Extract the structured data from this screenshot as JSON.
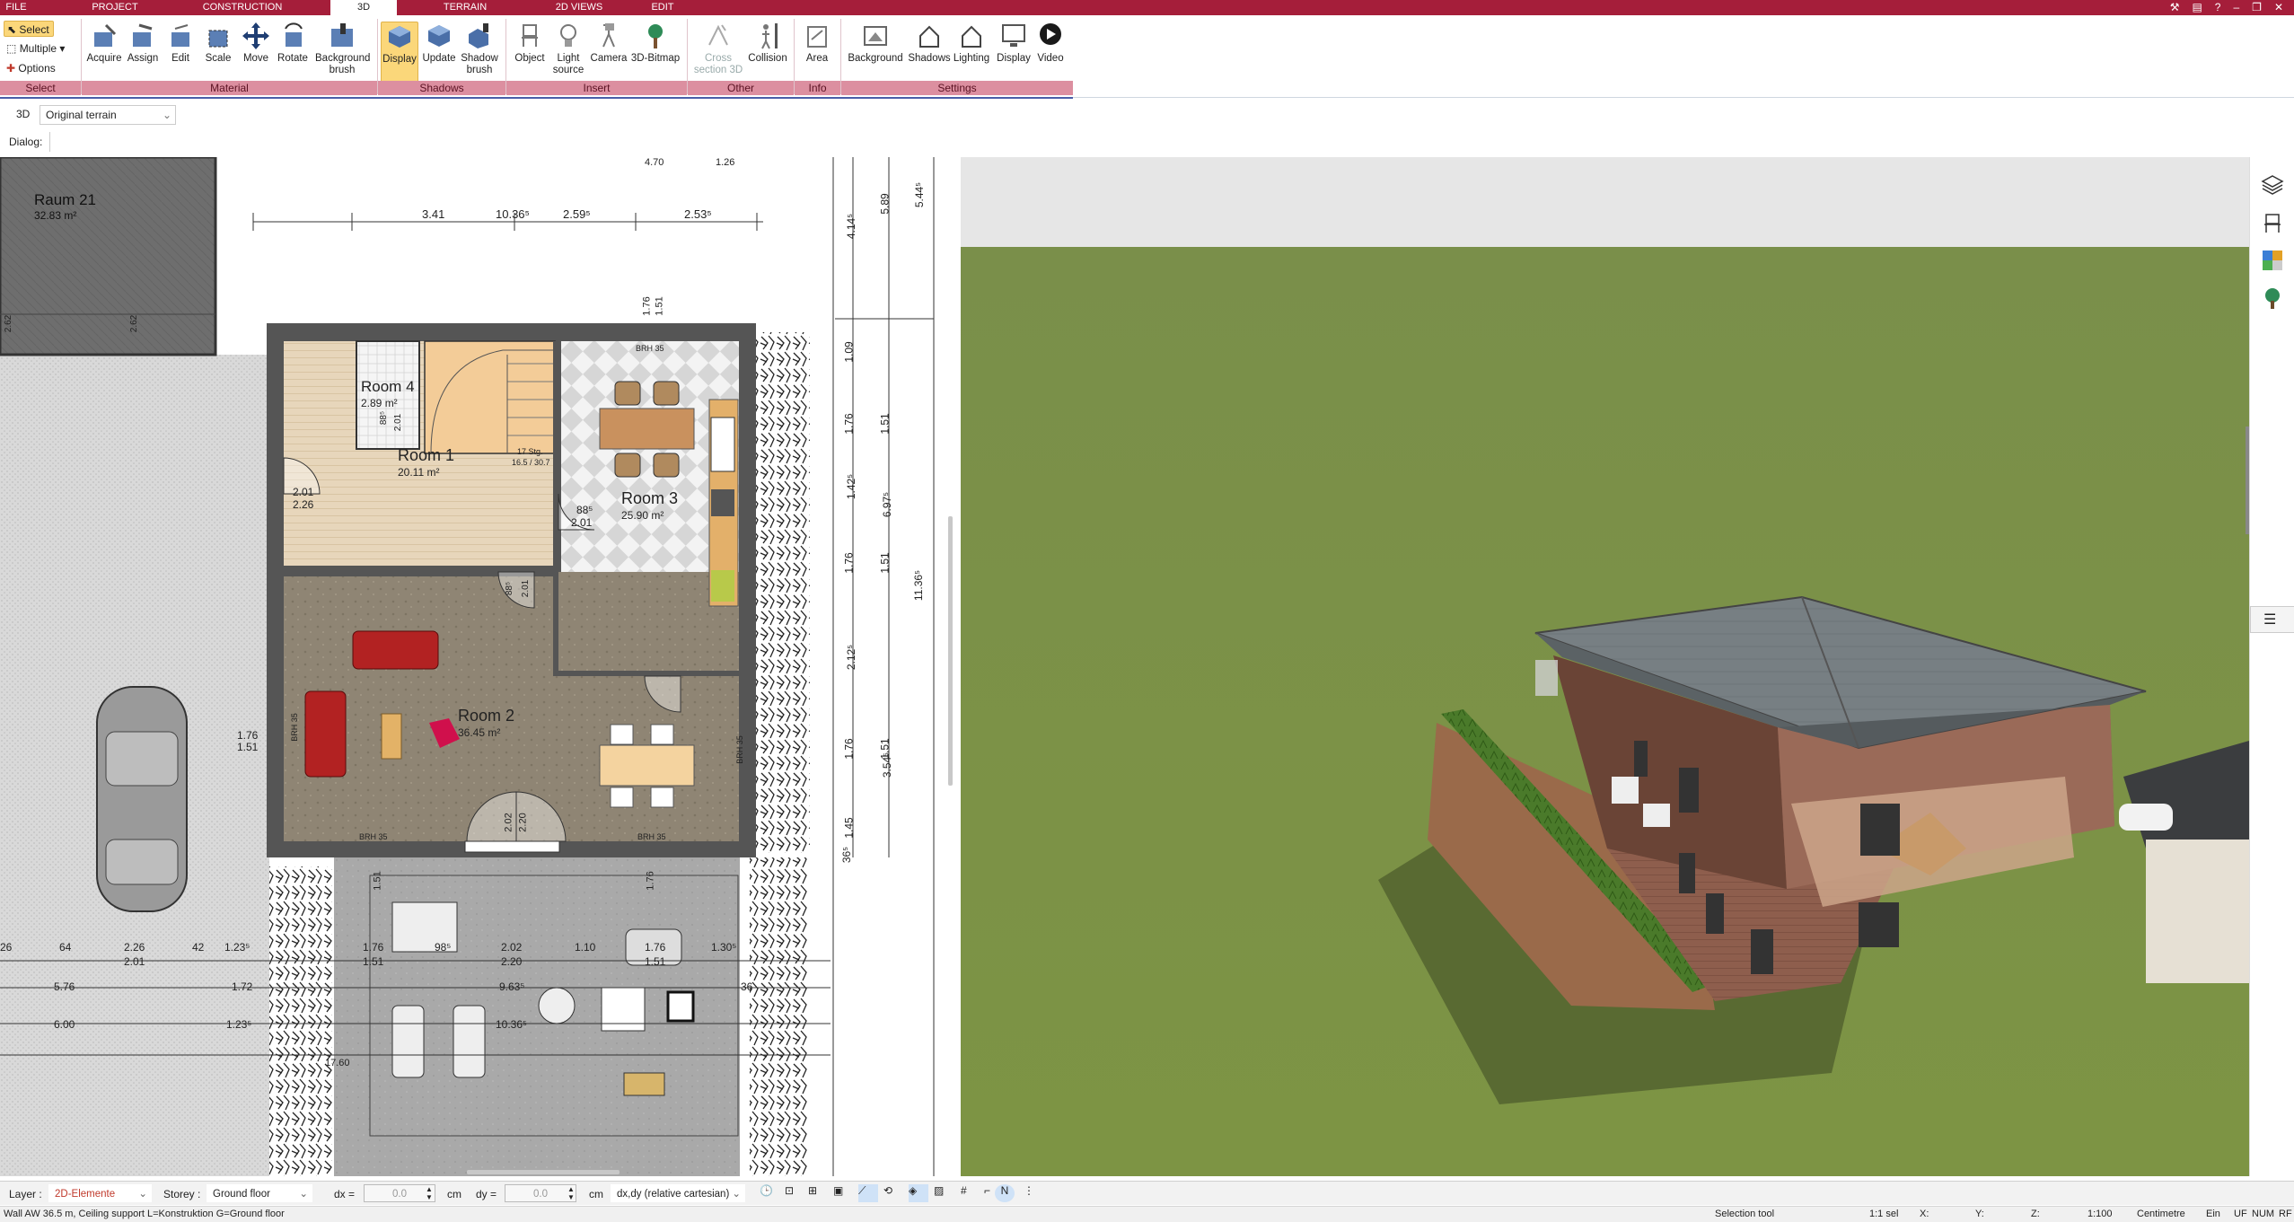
{
  "menu": {
    "tabs": [
      "FILE",
      "PROJECT",
      "CONSTRUCTION",
      "3D",
      "TERRAIN",
      "2D VIEWS",
      "EDIT"
    ],
    "active": "3D"
  },
  "ribbon": {
    "select": {
      "select_label": "Select",
      "multiple_label": "Multiple",
      "options_label": "Options"
    },
    "material": {
      "acquire": "Acquire",
      "assign": "Assign",
      "edit": "Edit",
      "scale": "Scale",
      "move": "Move",
      "rotate": "Rotate",
      "background_brush": "Background brush"
    },
    "shadows": {
      "display": "Display",
      "update": "Update",
      "shadow_brush": "Shadow brush"
    },
    "insert": {
      "object": "Object",
      "light_source": "Light source",
      "camera": "Camera",
      "bitmap": "3D-Bitmap"
    },
    "other": {
      "cross_section": "Cross section 3D",
      "collision": "Collision"
    },
    "info": {
      "area": "Area"
    },
    "settings": {
      "background": "Background",
      "shadows": "Shadows",
      "lighting": "Lighting",
      "display": "Display",
      "video": "Video"
    },
    "groups": {
      "select": "Select",
      "material": "Material",
      "shadows": "Shadows",
      "insert": "Insert",
      "other": "Other",
      "info": "Info",
      "settings": "Settings"
    }
  },
  "toolbar2": {
    "mode": "3D",
    "terrain_value": "Original terrain"
  },
  "dialog": {
    "label": "Dialog:"
  },
  "plan": {
    "rooms": [
      {
        "name": "Raum 21",
        "area": "32.83 m²"
      },
      {
        "name": "Room 4",
        "area": "2.89 m²"
      },
      {
        "name": "Room 1",
        "area": "20.11 m²"
      },
      {
        "name": "Room 3",
        "area": "25.90 m²"
      },
      {
        "name": "Room 2",
        "area": "36.45 m²"
      }
    ],
    "top_dims": [
      "3.41",
      "10.36⁵",
      "2.59⁵",
      "2.53⁵"
    ],
    "top_dims_small": [
      "4.70",
      "1.26"
    ],
    "right_dims_a": [
      "4.14⁵",
      "1.09",
      "1.76",
      "1.42⁵",
      "1.76",
      "2.12⁵",
      "1.76",
      "1.45",
      "36⁵"
    ],
    "right_dims_b": [
      "5.89",
      "1.51",
      "6.97⁵",
      "1.51",
      "1.51",
      "3.54⁵"
    ],
    "right_dims_c": [
      "5.44⁵",
      "11.36⁵"
    ],
    "brh": "BRH 35",
    "door_dims": [
      "2.01",
      "2.26",
      "88⁵",
      "2.01",
      "88⁵",
      "2.01",
      "88⁵",
      "2.01",
      "2.02",
      "2.20",
      "1.76",
      "1.51"
    ],
    "stair_label": "17 Stg.",
    "stair_dims": "16.5 / 30.7",
    "bottom_dims_row1": [
      "26",
      "64",
      "2.26",
      "42",
      "1.23⁵",
      "1.76",
      "98⁵",
      "2.02",
      "1.10",
      "1.76",
      "1.30⁵"
    ],
    "bottom_dims_row2": [
      "2.01",
      "1.51",
      "2.20",
      "1.51"
    ],
    "bottom_dims_row3": [
      "5.76",
      "1.72",
      "9.63⁵",
      "36"
    ],
    "bottom_dims_row4": [
      "6.00",
      "1.23⁵",
      "10.36⁵"
    ],
    "bottom_dim_small": "17.60",
    "left_dims": [
      "1.76",
      "1.51"
    ],
    "window_dims": [
      "2.62",
      "2.62",
      "1.51",
      "1.76"
    ]
  },
  "status": {
    "layer_label": "Layer :",
    "layer_value": "2D-Elemente",
    "storey_label": "Storey :",
    "storey_value": "Ground floor",
    "dx_label": "dx =",
    "dx_value": "0.0",
    "dy_label": "dy =",
    "dy_value": "0.0",
    "unit": "cm",
    "coord_mode": "dx,dy (relative cartesian)"
  },
  "infobar": {
    "element": "Wall AW 36.5 m, Ceiling support L=Konstruktion G=Ground floor",
    "tool": "Selection tool",
    "sel": "1:1 sel",
    "x": "X:",
    "y": "Y:",
    "z": "Z:",
    "scale": "1:100",
    "units": "Centimetre",
    "ein": "Ein",
    "uf": "UF",
    "num": "NUM",
    "rf": "RF"
  },
  "colors": {
    "brand": "#a51e3a",
    "group_band": "#dc8fa0",
    "active_tool": "#fbd77a",
    "grass": "#7a9145",
    "roof": "#7b8285",
    "brick": "#8a5b4a"
  }
}
